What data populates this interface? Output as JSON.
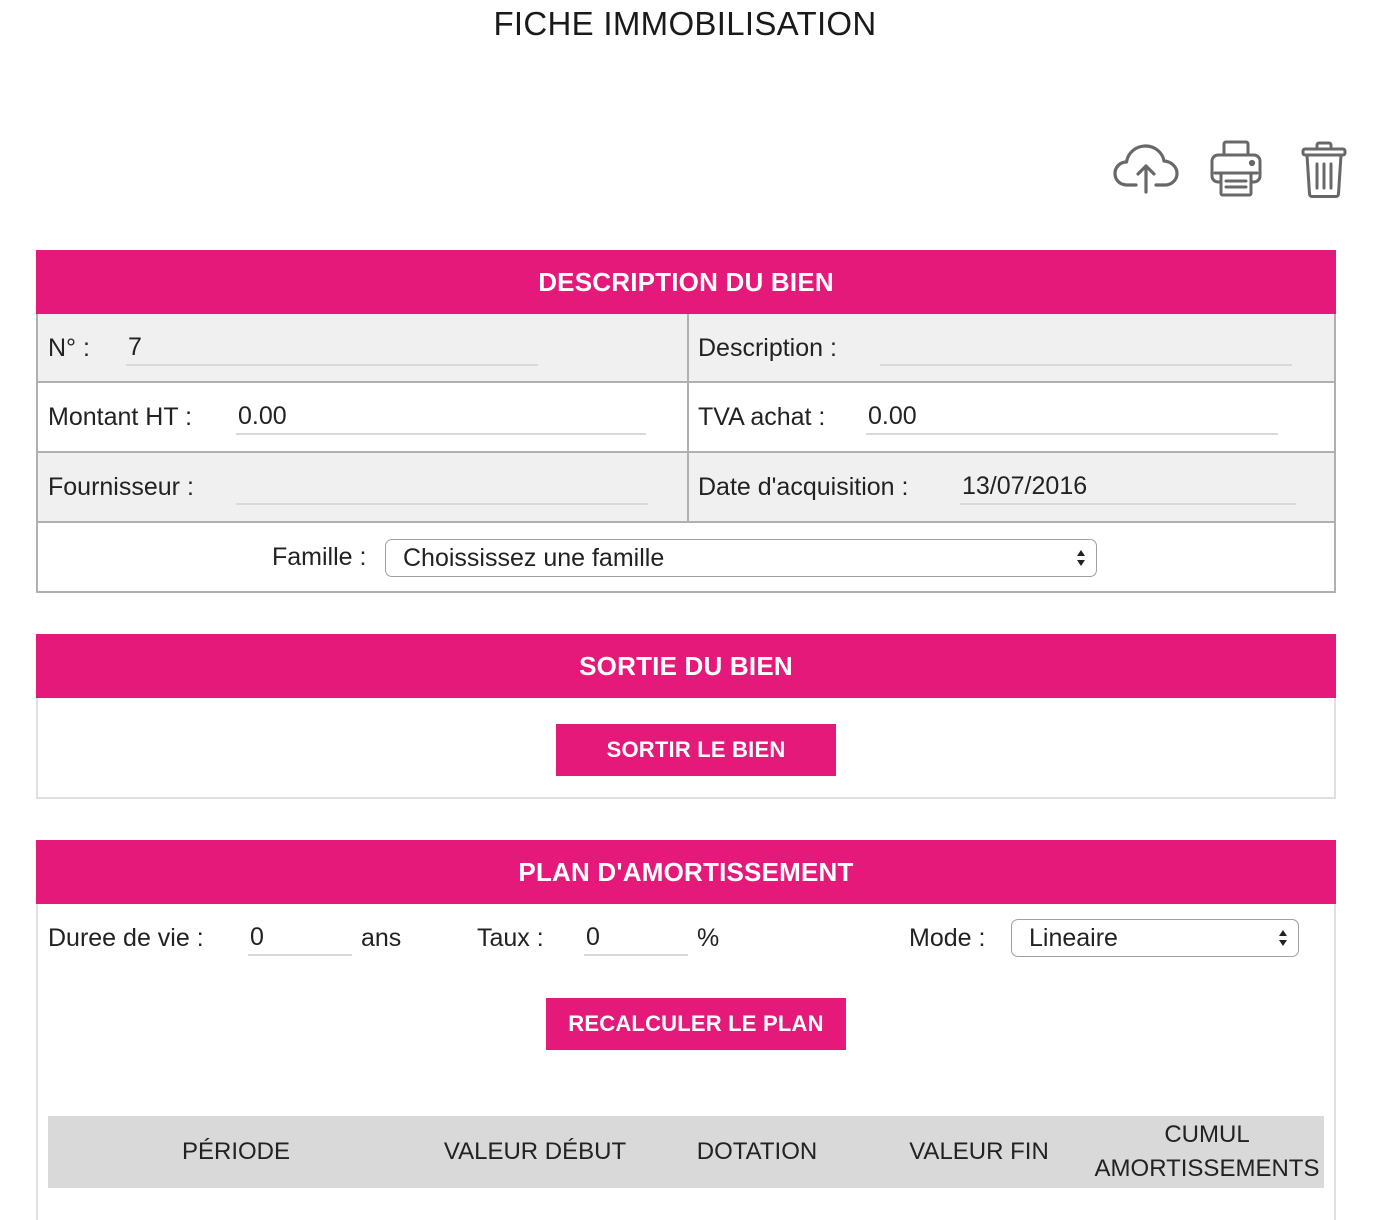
{
  "page": {
    "title": "FICHE IMMOBILISATION"
  },
  "toolbar": {
    "icons": {
      "upload": "cloud-upload",
      "print": "printer",
      "delete": "trash"
    }
  },
  "theme": {
    "accent": "#e5197a",
    "shaded_row": "#f0f0f0",
    "table_header": "#d9d9d9",
    "icon_color": "#686868"
  },
  "description_section": {
    "header": "DESCRIPTION DU BIEN",
    "numero": {
      "label": "N° :",
      "value": "7"
    },
    "description": {
      "label": "Description :",
      "value": ""
    },
    "montant_ht": {
      "label": "Montant HT :",
      "value": "0.00"
    },
    "tva_achat": {
      "label": "TVA achat :",
      "value": "0.00"
    },
    "fournisseur": {
      "label": "Fournisseur :",
      "value": ""
    },
    "date_acquisition": {
      "label": "Date d'acquisition :",
      "value": "13/07/2016"
    },
    "famille": {
      "label": "Famille :",
      "selected": "Choississez une famille"
    }
  },
  "sortie_section": {
    "header": "SORTIE DU BIEN",
    "button_label": "SORTIR LE BIEN"
  },
  "plan_section": {
    "header": "PLAN D'AMORTISSEMENT",
    "duree_vie": {
      "label": "Duree de vie :",
      "value": "0",
      "unit": "ans"
    },
    "taux": {
      "label": "Taux :",
      "value": "0",
      "unit": "%"
    },
    "mode": {
      "label": "Mode :",
      "selected": "Lineaire"
    },
    "button_label": "RECALCULER LE PLAN",
    "table": {
      "columns": [
        "PÉRIODE",
        "VALEUR DÉBUT",
        "DOTATION",
        "VALEUR FIN",
        "CUMUL AMORTISSEMENTS"
      ]
    }
  }
}
